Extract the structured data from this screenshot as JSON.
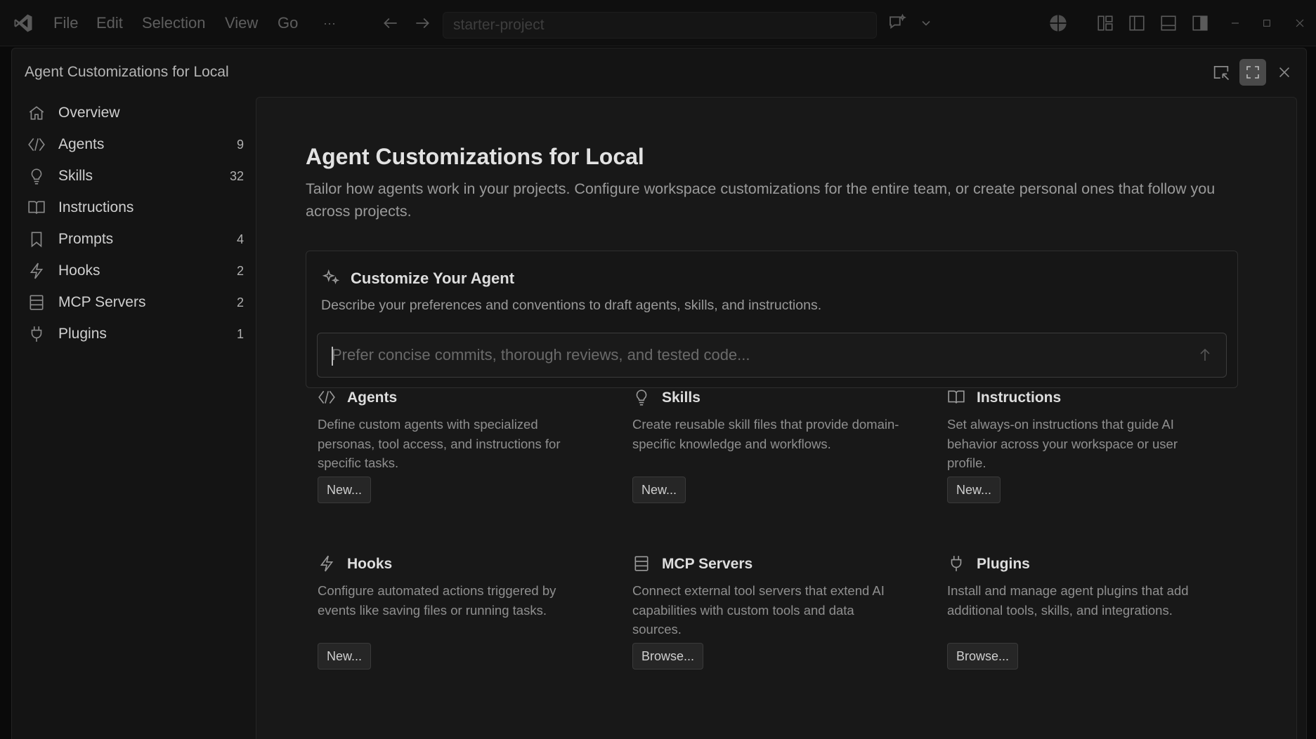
{
  "titlebar": {
    "app_icon": "vscode-logo-icon",
    "menus": [
      "File",
      "Edit",
      "Selection",
      "View",
      "Go"
    ],
    "more": "···",
    "search_text": "starter-project",
    "icons": [
      "back-arrow-icon",
      "forward-arrow-icon",
      "chat-sparkle-icon",
      "chevron-down-icon",
      "copilot-icon",
      "customize-layout-icon",
      "toggle-primary-sidebar-icon",
      "toggle-panel-icon",
      "toggle-secondary-sidebar-icon",
      "minimize-icon",
      "maximize-icon",
      "close-icon"
    ]
  },
  "dialog": {
    "title": "Agent Customizations for Local",
    "buttons": [
      "dock-icon",
      "maximize-icon",
      "close-icon"
    ]
  },
  "sidebar": {
    "items": [
      {
        "label": "Overview",
        "count": "",
        "icon": "home-icon"
      },
      {
        "label": "Agents",
        "count": "9",
        "icon": "agent-icon"
      },
      {
        "label": "Skills",
        "count": "32",
        "icon": "lightbulb-icon"
      },
      {
        "label": "Instructions",
        "count": "",
        "icon": "book-icon"
      },
      {
        "label": "Prompts",
        "count": "4",
        "icon": "bookmark-icon"
      },
      {
        "label": "Hooks",
        "count": "2",
        "icon": "lightning-icon"
      },
      {
        "label": "MCP Servers",
        "count": "2",
        "icon": "server-icon"
      },
      {
        "label": "Plugins",
        "count": "1",
        "icon": "plug-icon"
      }
    ]
  },
  "main": {
    "title": "Agent Customizations for Local",
    "description": "Tailor how agents work in your projects. Configure workspace customizations for the entire team, or create personal ones that follow you across projects.",
    "customize": {
      "title": "Customize Your Agent",
      "description": "Describe your preferences and conventions to draft agents, skills, and instructions.",
      "placeholder": "Prefer concise commits, thorough reviews, and tested code...",
      "value": ""
    },
    "cards": [
      {
        "title": "Agents",
        "description": "Define custom agents with specialized personas, tool access, and instructions for specific tasks.",
        "button": "New...",
        "icon": "agent-icon"
      },
      {
        "title": "Skills",
        "description": "Create reusable skill files that provide domain-specific knowledge and workflows.",
        "button": "New...",
        "icon": "lightbulb-icon"
      },
      {
        "title": "Instructions",
        "description": "Set always-on instructions that guide AI behavior across your workspace or user profile.",
        "button": "New...",
        "icon": "book-icon"
      },
      {
        "title": "Hooks",
        "description": "Configure automated actions triggered by events like saving files or running tasks.",
        "button": "New...",
        "icon": "lightning-icon"
      },
      {
        "title": "MCP Servers",
        "description": "Connect external tool servers that extend AI capabilities with custom tools and data sources.",
        "button": "Browse...",
        "icon": "server-icon"
      },
      {
        "title": "Plugins",
        "description": "Install and manage agent plugins that add additional tools, skills, and integrations.",
        "button": "Browse...",
        "icon": "plug-icon"
      }
    ]
  },
  "colors": {
    "background": "#0a0a0a",
    "dialog": "#141414",
    "panel": "#181818",
    "text": "#cccccc",
    "muted_text": "#8f8f8f",
    "border": "#2e2e2e"
  }
}
